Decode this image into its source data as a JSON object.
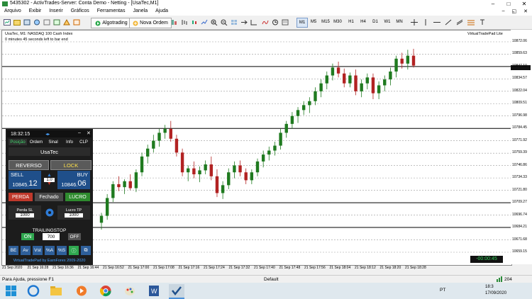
{
  "window": {
    "title": "5435302 - ActivTrades-Server: Conta Demo - Netting - [UsaTec,M1]",
    "btn_min": "–",
    "btn_max": "□",
    "btn_close": "✕"
  },
  "menu": {
    "items": [
      "Arquivo",
      "Exibir",
      "Inserir",
      "Gráficos",
      "Ferramentas",
      "Janela",
      "Ajuda"
    ],
    "right": [
      "–",
      "◱",
      "✕"
    ]
  },
  "toolbar": {
    "algo_label": "Algotrading",
    "new_order_label": "Nova Ordem",
    "timeframes": [
      "M1",
      "M5",
      "M15",
      "M30",
      "H1",
      "H4",
      "D1",
      "W1",
      "MN"
    ],
    "selected_tf": "M1"
  },
  "chart": {
    "symbol_info": "UsaTec, M1:  NASDAQ 100 Cash Index",
    "countdown_text": "0 minutes 45 seconds left to bar end",
    "plugin_label": "VirtualTradePad",
    "plugin_link": "Lite",
    "timer_badge": "-00:00:45"
  },
  "yaxis": [
    "10872.06",
    "10859.63",
    "10847.10",
    "10834.57",
    "10822.04",
    "10809.51",
    "10796.98",
    "10784.45",
    "10771.92",
    "10759.39",
    "10746.86",
    "10734.33",
    "10721.80",
    "10709.27",
    "10696.74",
    "10684.21",
    "10671.68",
    "10659.15"
  ],
  "xaxis": [
    "21 Sep 2020",
    "21 Sep 16:28",
    "21 Sep 16:36",
    "21 Sep 16:44",
    "21 Sep 16:52",
    "21 Sep 17:00",
    "21 Sep 17:08",
    "21 Sep 17:16",
    "21 Sep 17:24",
    "21 Sep 17:32",
    "21 Sep 17:40",
    "21 Sep 17:48",
    "21 Sep 17:56",
    "21 Sep 18:04",
    "21 Sep 18:12",
    "21 Sep 18:20",
    "21 Sep 18:28"
  ],
  "candles": [
    [
      10689,
      10699,
      10682,
      10696
    ],
    [
      10696,
      10718,
      10692,
      10714
    ],
    [
      10714,
      10731,
      10710,
      10728
    ],
    [
      10728,
      10736,
      10721,
      10725
    ],
    [
      10725,
      10733,
      10718,
      10731
    ],
    [
      10731,
      10738,
      10722,
      10724
    ],
    [
      10724,
      10743,
      10720,
      10740
    ],
    [
      10740,
      10760,
      10736,
      10756
    ],
    [
      10756,
      10768,
      10749,
      10764
    ],
    [
      10764,
      10778,
      10760,
      10772
    ],
    [
      10772,
      10784,
      10766,
      10780
    ],
    [
      10780,
      10788,
      10774,
      10784
    ],
    [
      10784,
      10792,
      10771,
      10774
    ],
    [
      10774,
      10778,
      10756,
      10760
    ],
    [
      10760,
      10764,
      10736,
      10740
    ],
    [
      10740,
      10747,
      10731,
      10744
    ],
    [
      10744,
      10751,
      10734,
      10738
    ],
    [
      10738,
      10746,
      10730,
      10742
    ],
    [
      10742,
      10752,
      10738,
      10748
    ],
    [
      10748,
      10756,
      10732,
      10736
    ],
    [
      10736,
      10743,
      10715,
      10719
    ],
    [
      10719,
      10731,
      10713,
      10727
    ],
    [
      10727,
      10744,
      10723,
      10740
    ],
    [
      10740,
      10751,
      10734,
      10747
    ],
    [
      10747,
      10752,
      10736,
      10740
    ],
    [
      10740,
      10744,
      10728,
      10732
    ],
    [
      10732,
      10743,
      10728,
      10740
    ],
    [
      10740,
      10754,
      10736,
      10751
    ],
    [
      10751,
      10762,
      10745,
      10758
    ],
    [
      10758,
      10766,
      10752,
      10762
    ],
    [
      10762,
      10771,
      10757,
      10767
    ],
    [
      10767,
      10784,
      10763,
      10780
    ],
    [
      10780,
      10792,
      10775,
      10789
    ],
    [
      10789,
      10801,
      10784,
      10797
    ],
    [
      10797,
      10806,
      10790,
      10803
    ],
    [
      10803,
      10812,
      10798,
      10808
    ],
    [
      10808,
      10816,
      10800,
      10812
    ],
    [
      10812,
      10826,
      10808,
      10822
    ],
    [
      10822,
      10834,
      10816,
      10830
    ],
    [
      10830,
      10842,
      10824,
      10838
    ],
    [
      10838,
      10850,
      10833,
      10846
    ],
    [
      10846,
      10852,
      10836,
      10840
    ],
    [
      10840,
      10845,
      10826,
      10830
    ],
    [
      10830,
      10841,
      10826,
      10838
    ],
    [
      10838,
      10844,
      10818,
      10822
    ],
    [
      10822,
      10834,
      10816,
      10830
    ],
    [
      10830,
      10840,
      10824,
      10836
    ],
    [
      10836,
      10840,
      10814,
      10820
    ],
    [
      10820,
      10832,
      10814,
      10828
    ],
    [
      10828,
      10838,
      10822,
      10834
    ],
    [
      10834,
      10846,
      10828,
      10842
    ],
    [
      10842,
      10858,
      10836,
      10855
    ],
    [
      10855,
      10861,
      10845,
      10850
    ],
    [
      10850,
      10864,
      10844,
      10858
    ],
    [
      10858,
      10865,
      10846,
      10848
    ]
  ],
  "panel": {
    "time": "18:32:15",
    "close": "✕",
    "min": "–",
    "tabs": [
      "Posição",
      "Ordem",
      "Sinal",
      "Info",
      "CLP"
    ],
    "symbol": "UsaTec",
    "reverso": "REVERSO",
    "lock": "LOCK",
    "sell_label": "SELL",
    "buy_label": "BUY",
    "sell_price_main": "10845.",
    "sell_price_big": "12",
    "buy_price_main": "10846.",
    "buy_price_big": "06",
    "lot": "1.0",
    "perda": "PERDA",
    "fechado": "Fechado",
    "lucro": "LUCRO",
    "perda_sl_label": "Perda SL",
    "lucro_tp_label": "Lucro TP",
    "perda_sl_value": "1000",
    "lucro_tp_value": "1000",
    "trailing_label": "TRAILINGSTOP",
    "on": "ON",
    "trailing_value": "700",
    "off": "OFF",
    "bottom_buttons": [
      "BE",
      "Av",
      "Vst",
      "%A",
      "%S",
      "ⓘ",
      "⧉"
    ],
    "footer": "VirtualTradePad by EarnForex 2009-2020"
  },
  "status": {
    "help": "Para Ajuda, pressione F1",
    "profile": "Default",
    "bars": "204"
  },
  "taskbar": {
    "lang": "PT",
    "time": "18:3",
    "date": "17/09/2020"
  },
  "colors": {
    "panel_bg": "#1c1c1c",
    "sell": "#1f4f8a",
    "buy": "#1f4f8a",
    "perda": "#c0392b",
    "lucro": "#2e8b2e",
    "on": "#2fa84f",
    "candle": "#1f7a1f",
    "candle_down": "#b22222"
  }
}
